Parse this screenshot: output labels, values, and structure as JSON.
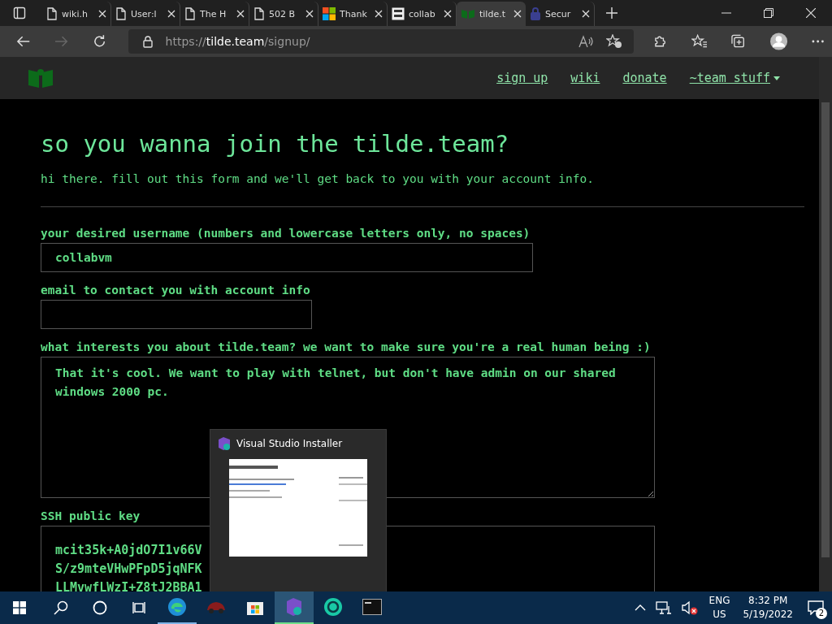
{
  "browser": {
    "tabs": [
      {
        "label": "wiki.h",
        "kind": "page",
        "selected": false
      },
      {
        "label": "User:l",
        "kind": "page",
        "selected": false
      },
      {
        "label": "The H",
        "kind": "page",
        "selected": false
      },
      {
        "label": "502 B",
        "kind": "page",
        "selected": false
      },
      {
        "label": "Thank",
        "kind": "windows",
        "selected": false
      },
      {
        "label": "collab",
        "kind": "binary",
        "selected": false
      },
      {
        "label": "tilde.t",
        "kind": "tilde",
        "selected": true
      },
      {
        "label": "Secur",
        "kind": "shield",
        "selected": false
      }
    ],
    "url": {
      "scheme": "https://",
      "host": "tilde.team",
      "path": "/signup/"
    }
  },
  "site_nav": {
    "links": [
      {
        "label": "sign up",
        "dropdown": false
      },
      {
        "label": "wiki",
        "dropdown": false
      },
      {
        "label": "donate",
        "dropdown": false
      },
      {
        "label": "~team stuff ",
        "dropdown": true
      }
    ]
  },
  "page": {
    "heading": "so you wanna join the tilde.team?",
    "intro": "hi there. fill out this form and we'll get back to you with your account info.",
    "fields": [
      {
        "kind": "input",
        "label": "your desired username (numbers and lowercase letters only, no spaces)",
        "value": "collabvm"
      },
      {
        "kind": "input",
        "label": "email to contact you with account info"
      },
      {
        "kind": "textarea",
        "label": "what interests you about tilde.team? we want to make sure you're a real human being :)",
        "value": "That it's cool. We want to play with telnet, but don't have admin on our shared windows 2000 pc."
      },
      {
        "kind": "key",
        "label": "SSH public key",
        "lines": [
          "mcit35k+A0jdO7I1v66V",
          "S/z9mteVHwPFpD5jqNFK",
          "LLMvwfLWzI+Z8tJ2BBA1"
        ]
      }
    ]
  },
  "taskbar_preview": {
    "title": "Visual Studio Installer"
  },
  "taskbar": {
    "apps": [
      {
        "kind": "edge",
        "running": true,
        "selected": false
      },
      {
        "kind": "car",
        "running": false,
        "selected": false
      },
      {
        "kind": "store",
        "running": false,
        "selected": false
      },
      {
        "kind": "vs",
        "running": true,
        "selected": true
      },
      {
        "kind": "ring",
        "running": false,
        "selected": false
      },
      {
        "kind": "terminal",
        "running": false,
        "selected": false
      }
    ],
    "language": "ENG",
    "region": "US",
    "time": "8:32 PM",
    "date": "5/19/2022",
    "notifications": "2"
  }
}
